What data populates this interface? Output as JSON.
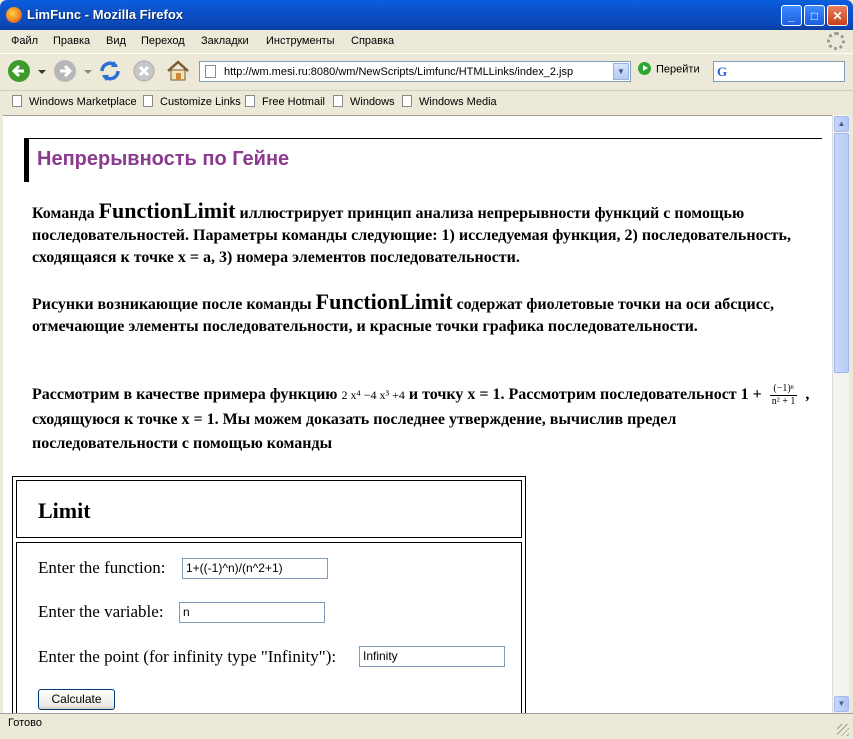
{
  "window": {
    "title": "LimFunc - Mozilla Firefox"
  },
  "menu": {
    "items": [
      "Файл",
      "Правка",
      "Вид",
      "Переход",
      "Закладки",
      "Инструменты",
      "Справка"
    ]
  },
  "toolbar": {
    "url": "http://wm.mesi.ru:8080/wm/NewScripts/Limfunc/HTMLLinks/index_2.jsp",
    "go_label": "Перейти",
    "search_engine": "G",
    "search_value": ""
  },
  "bookmarks": [
    "Windows Marketplace",
    "Customize Links",
    "Free Hotmail",
    "Windows",
    "Windows Media"
  ],
  "page": {
    "heading": "Непрерывность по Гейне",
    "p1_pre": "Команда ",
    "p1_cmd": "FunctionLimit",
    "p1_post": " иллюстрирует принцип анализа непрерывности функций с помощью последовательностей. Параметры команды следующие: 1) исследуемая функция, 2) последовательность, сходящаяся к точке   x = a, 3) номера элементов последовательности.",
    "p2_pre": "Рисунки возникающие после команды ",
    "p2_cmd": "FunctionLimit",
    "p2_post": " содержат фиолетовые точки на оси абсцисс, отмечающие элементы последовательности, и красные точки графика последовательности.",
    "p3_a": "Рассмотрим в качестве примера функцию ",
    "p3_formula": "2 x⁴ −4  x³ +4",
    "p3_b": "  и точку x = 1.   Рассмотрим последовательност 1 + ",
    "p3_frac_num": "(−1)ⁿ",
    "p3_frac_den": "n² + 1",
    "p3_c": " , сходящуюся к точке x = 1. Мы можем доказать последнее утверждение, вычислив предел последовательности с помощью команды"
  },
  "limit_form": {
    "title": "Limit",
    "function_label": "Enter the function:",
    "function_value": "1+((-1)^n)/(n^2+1)",
    "variable_label": "Enter the variable:",
    "variable_value": "n",
    "point_label": "Enter the point (for infinity type \"Infinity\"):",
    "point_value": "Infinity",
    "calculate_label": "Calculate"
  },
  "status": {
    "text": "Готово"
  }
}
